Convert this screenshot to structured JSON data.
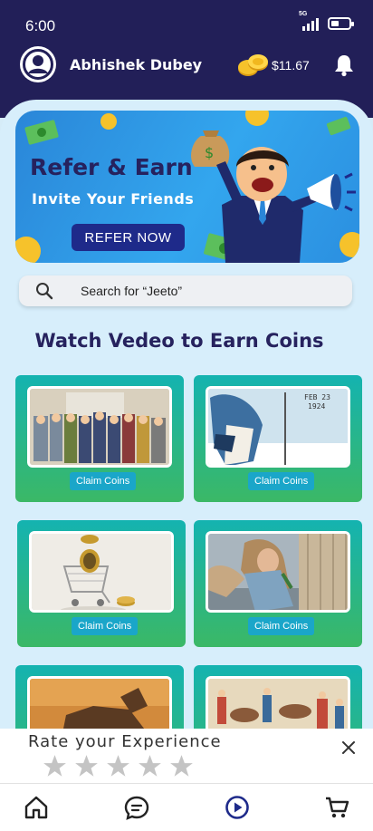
{
  "status": {
    "time": "6:00",
    "network": "5G"
  },
  "header": {
    "user_name": "Abhishek Dubey",
    "balance": "$11.67"
  },
  "banner": {
    "title": "Refer & Earn",
    "subtitle": "Invite Your Friends",
    "button": "REFER NOW"
  },
  "search": {
    "placeholder": "Search for “Jeeto”"
  },
  "section_title": "Watch Vedeo to Earn Coins",
  "videos": [
    {
      "claim_label": "Claim Coins"
    },
    {
      "claim_label": "Claim Coins"
    },
    {
      "claim_label": "Claim Coins"
    },
    {
      "claim_label": "Claim Coins"
    }
  ],
  "rating": {
    "title": "Rate your Experience",
    "stars": 5,
    "selected": 0
  },
  "nav": [
    "home-icon",
    "chat-icon",
    "play-icon",
    "cart-icon"
  ],
  "colors": {
    "header": "#221f58",
    "accent": "#1e2a8a",
    "card_top": "#14b3b0",
    "card_bottom": "#3bb866",
    "claim": "#1aa6c9"
  }
}
